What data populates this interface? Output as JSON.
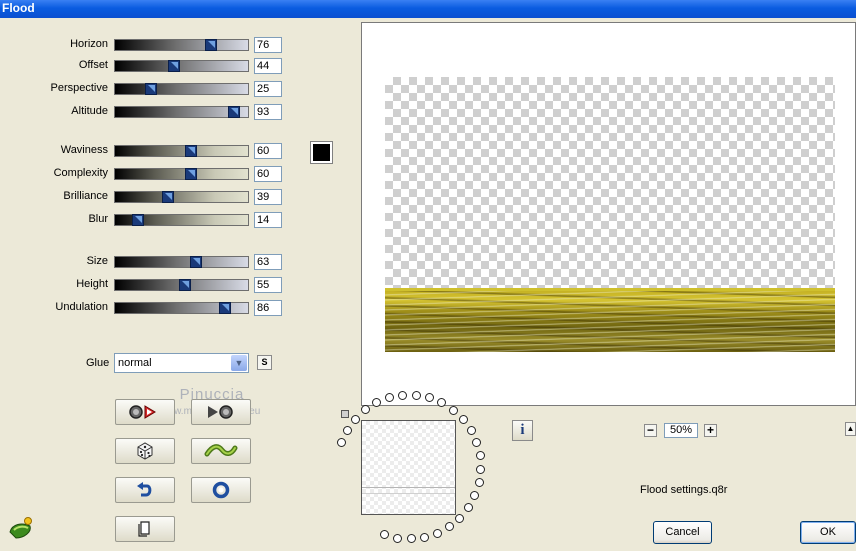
{
  "window": {
    "title": "Flood"
  },
  "sliders": [
    {
      "id": "horizon",
      "label": "Horizon",
      "value": "76",
      "fraction": 0.74,
      "style": "gray"
    },
    {
      "id": "offset",
      "label": "Offset",
      "value": "44",
      "fraction": 0.44,
      "style": "gray"
    },
    {
      "id": "perspective",
      "label": "Perspective",
      "value": "25",
      "fraction": 0.25,
      "style": "gray"
    },
    {
      "id": "altitude",
      "label": "Altitude",
      "value": "93",
      "fraction": 0.93,
      "style": "gray"
    },
    {
      "id": "waviness",
      "label": "Waviness",
      "value": "60",
      "fraction": 0.58,
      "style": "beige"
    },
    {
      "id": "complexity",
      "label": "Complexity",
      "value": "60",
      "fraction": 0.58,
      "style": "beige"
    },
    {
      "id": "brilliance",
      "label": "Brilliance",
      "value": "39",
      "fraction": 0.39,
      "style": "beige"
    },
    {
      "id": "blur",
      "label": "Blur",
      "value": "14",
      "fraction": 0.14,
      "style": "beige"
    },
    {
      "id": "size",
      "label": "Size",
      "value": "63",
      "fraction": 0.62,
      "style": "gray"
    },
    {
      "id": "height",
      "label": "Height",
      "value": "55",
      "fraction": 0.53,
      "style": "gray"
    },
    {
      "id": "undulation",
      "label": "Undulation",
      "value": "86",
      "fraction": 0.86,
      "style": "gray"
    }
  ],
  "color": {
    "swatch": "#000000"
  },
  "glue": {
    "label": "Glue",
    "value": "normal",
    "sync_label": "S"
  },
  "watermark": {
    "name": "Pinuccia",
    "url": "www.moidiregrafica.eu"
  },
  "tools": {
    "compare_icon": "compare-before-after-icon",
    "random_icon": "dice-icon",
    "wave_icon": "wave-icon",
    "undo_icon": "undo-icon",
    "reset_icon": "reset-icon",
    "page_icon": "page-icon"
  },
  "preview": {
    "zoom": "50%",
    "info_label": "i"
  },
  "preset": {
    "name": "Flood settings.q8r"
  },
  "buttons": {
    "cancel": "Cancel",
    "ok": "OK"
  },
  "colors": {
    "title_bar": "#0a5ce0",
    "water": "#c5b224"
  }
}
